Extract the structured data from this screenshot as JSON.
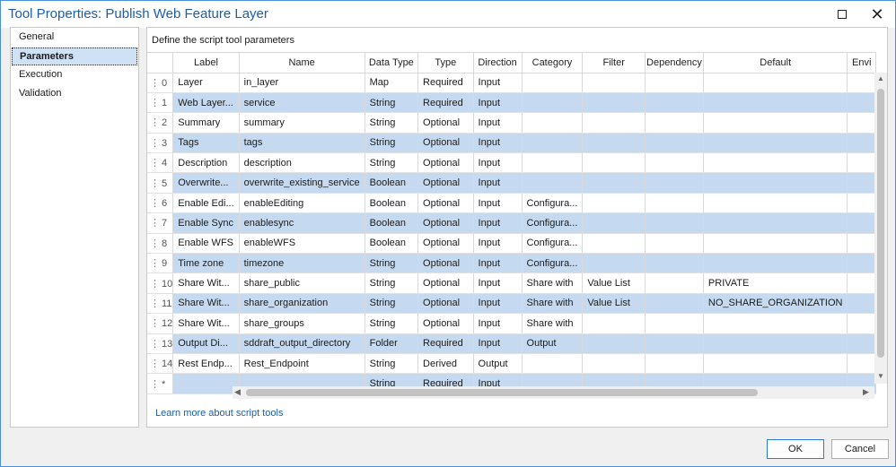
{
  "window": {
    "title": "Tool Properties: Publish Web Feature Layer",
    "maximize_icon": "maximize-icon",
    "close_icon": "close-icon"
  },
  "sidebar": {
    "items": [
      {
        "label": "General",
        "active": false
      },
      {
        "label": "Parameters",
        "active": true
      },
      {
        "label": "Execution",
        "active": false
      },
      {
        "label": "Validation",
        "active": false
      }
    ]
  },
  "panel": {
    "heading": "Define the script tool parameters",
    "columns": [
      "",
      "Label",
      "Name",
      "Data Type",
      "Type",
      "Direction",
      "Category",
      "Filter",
      "Dependency",
      "Default",
      "Envi"
    ],
    "rows": [
      {
        "idx": "0",
        "label": "Layer",
        "name": "in_layer",
        "datatype": "Map",
        "type": "Required",
        "direction": "Input",
        "category": "",
        "filter": "",
        "dependency": "",
        "default": ""
      },
      {
        "idx": "1",
        "label": "Web Layer...",
        "name": "service",
        "datatype": "String",
        "type": "Required",
        "direction": "Input",
        "category": "",
        "filter": "",
        "dependency": "",
        "default": ""
      },
      {
        "idx": "2",
        "label": "Summary",
        "name": "summary",
        "datatype": "String",
        "type": "Optional",
        "direction": "Input",
        "category": "",
        "filter": "",
        "dependency": "",
        "default": ""
      },
      {
        "idx": "3",
        "label": "Tags",
        "name": "tags",
        "datatype": "String",
        "type": "Optional",
        "direction": "Input",
        "category": "",
        "filter": "",
        "dependency": "",
        "default": ""
      },
      {
        "idx": "4",
        "label": "Description",
        "name": "description",
        "datatype": "String",
        "type": "Optional",
        "direction": "Input",
        "category": "",
        "filter": "",
        "dependency": "",
        "default": ""
      },
      {
        "idx": "5",
        "label": "Overwrite...",
        "name": "overwrite_existing_service",
        "datatype": "Boolean",
        "type": "Optional",
        "direction": "Input",
        "category": "",
        "filter": "",
        "dependency": "",
        "default": ""
      },
      {
        "idx": "6",
        "label": "Enable Edi...",
        "name": "enableEditing",
        "datatype": "Boolean",
        "type": "Optional",
        "direction": "Input",
        "category": "Configura...",
        "filter": "",
        "dependency": "",
        "default": ""
      },
      {
        "idx": "7",
        "label": "Enable Sync",
        "name": "enablesync",
        "datatype": "Boolean",
        "type": "Optional",
        "direction": "Input",
        "category": "Configura...",
        "filter": "",
        "dependency": "",
        "default": ""
      },
      {
        "idx": "8",
        "label": "Enable WFS",
        "name": "enableWFS",
        "datatype": "Boolean",
        "type": "Optional",
        "direction": "Input",
        "category": "Configura...",
        "filter": "",
        "dependency": "",
        "default": ""
      },
      {
        "idx": "9",
        "label": "Time zone",
        "name": "timezone",
        "datatype": "String",
        "type": "Optional",
        "direction": "Input",
        "category": "Configura...",
        "filter": "",
        "dependency": "",
        "default": ""
      },
      {
        "idx": "10",
        "label": "Share Wit...",
        "name": "share_public",
        "datatype": "String",
        "type": "Optional",
        "direction": "Input",
        "category": "Share with",
        "filter": "Value List",
        "dependency": "",
        "default": "PRIVATE"
      },
      {
        "idx": "11",
        "label": "Share Wit...",
        "name": "share_organization",
        "datatype": "String",
        "type": "Optional",
        "direction": "Input",
        "category": "Share with",
        "filter": "Value List",
        "dependency": "",
        "default": "NO_SHARE_ORGANIZATION"
      },
      {
        "idx": "12",
        "label": "Share Wit...",
        "name": "share_groups",
        "datatype": "String",
        "type": "Optional",
        "direction": "Input",
        "category": "Share with",
        "filter": "",
        "dependency": "",
        "default": ""
      },
      {
        "idx": "13",
        "label": "Output Di...",
        "name": "sddraft_output_directory",
        "datatype": "Folder",
        "type": "Required",
        "direction": "Input",
        "category": "Output",
        "filter": "",
        "dependency": "",
        "default": ""
      },
      {
        "idx": "14",
        "label": "Rest Endp...",
        "name": "Rest_Endpoint",
        "datatype": "String",
        "type": "Derived",
        "direction": "Output",
        "category": "",
        "filter": "",
        "dependency": "",
        "default": ""
      },
      {
        "idx": "*",
        "label": "",
        "name": "",
        "datatype": "String",
        "type": "Required",
        "direction": "Input",
        "category": "",
        "filter": "",
        "dependency": "",
        "default": ""
      }
    ],
    "learn_more": "Learn more about script tools"
  },
  "footer": {
    "ok_label": "OK",
    "cancel_label": "Cancel"
  }
}
